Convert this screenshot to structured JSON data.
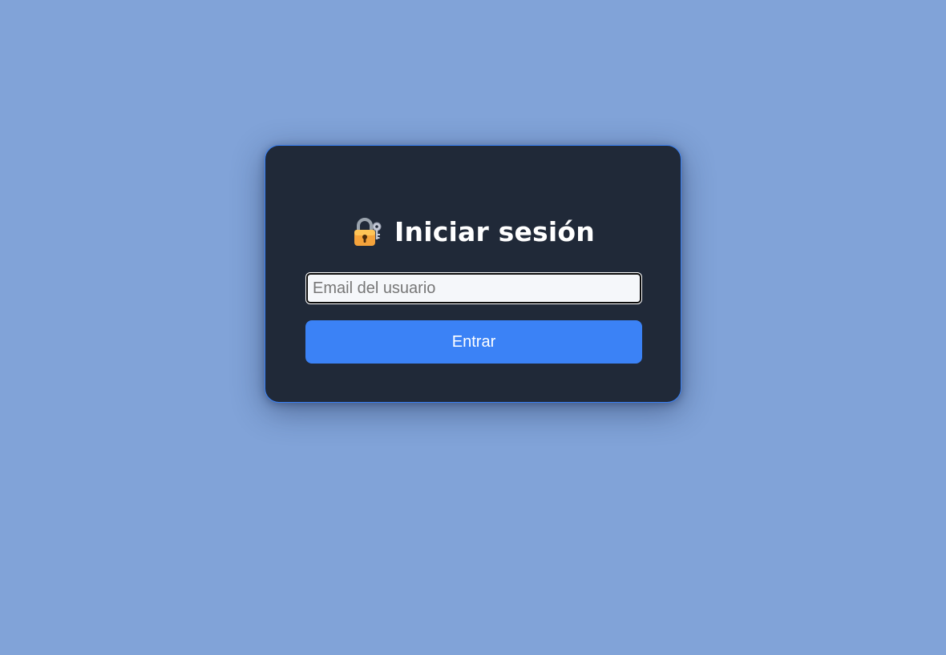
{
  "login": {
    "title": "Iniciar sesión",
    "title_icon": "lock-with-key-icon",
    "email_placeholder": "Email del usuario",
    "email_value": "",
    "submit_label": "Entrar"
  },
  "colors": {
    "background": "#81a3d8",
    "card": "#202938",
    "accent": "#3b82f6"
  }
}
